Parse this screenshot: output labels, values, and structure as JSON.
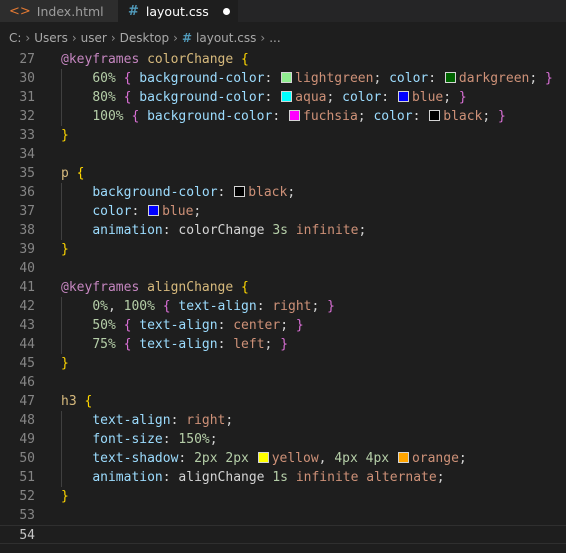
{
  "tabs": [
    {
      "label": "Index.html",
      "icon": "html-file-icon"
    },
    {
      "label": "layout.css",
      "icon": "css-file-icon",
      "modified": true
    }
  ],
  "breadcrumb": [
    "C:",
    "Users",
    "user",
    "Desktop",
    "layout.css",
    "..."
  ],
  "colors": {
    "lightgreen": "#90ee90",
    "darkgreen": "#006400",
    "aqua": "#00ffff",
    "blue": "#0000ff",
    "fuchsia": "#ff00ff",
    "black": "#000000",
    "yellow": "#ffff00",
    "orange": "#ffa500"
  },
  "lines": [
    {
      "n": "27",
      "tokens": [
        [
          "kw",
          "@keyframes"
        ],
        [
          "sel",
          " colorChange "
        ],
        [
          "br1",
          "{"
        ]
      ]
    },
    {
      "n": "30",
      "tokens": [
        [
          "ws",
          "    "
        ],
        [
          "num",
          "60%"
        ],
        [
          "punc",
          " "
        ],
        [
          "br2",
          "{"
        ],
        [
          "punc",
          " "
        ],
        [
          "prop",
          "background-color"
        ],
        [
          "punc",
          ": "
        ],
        [
          "sw",
          "lightgreen"
        ],
        [
          "val",
          "lightgreen"
        ],
        [
          "punc",
          "; "
        ],
        [
          "prop",
          "color"
        ],
        [
          "punc",
          ": "
        ],
        [
          "sw",
          "darkgreen"
        ],
        [
          "val",
          "darkgreen"
        ],
        [
          "punc",
          "; "
        ],
        [
          "br2",
          "}"
        ]
      ]
    },
    {
      "n": "31",
      "tokens": [
        [
          "ws",
          "    "
        ],
        [
          "num",
          "80%"
        ],
        [
          "punc",
          " "
        ],
        [
          "br2",
          "{"
        ],
        [
          "punc",
          " "
        ],
        [
          "prop",
          "background-color"
        ],
        [
          "punc",
          ": "
        ],
        [
          "sw",
          "aqua"
        ],
        [
          "val",
          "aqua"
        ],
        [
          "punc",
          "; "
        ],
        [
          "prop",
          "color"
        ],
        [
          "punc",
          ": "
        ],
        [
          "sw",
          "blue"
        ],
        [
          "val",
          "blue"
        ],
        [
          "punc",
          "; "
        ],
        [
          "br2",
          "}"
        ]
      ]
    },
    {
      "n": "32",
      "tokens": [
        [
          "ws",
          "    "
        ],
        [
          "num",
          "100%"
        ],
        [
          "punc",
          " "
        ],
        [
          "br2",
          "{"
        ],
        [
          "punc",
          " "
        ],
        [
          "prop",
          "background-color"
        ],
        [
          "punc",
          ": "
        ],
        [
          "sw",
          "fuchsia"
        ],
        [
          "val",
          "fuchsia"
        ],
        [
          "punc",
          "; "
        ],
        [
          "prop",
          "color"
        ],
        [
          "punc",
          ": "
        ],
        [
          "sw",
          "black"
        ],
        [
          "val",
          "black"
        ],
        [
          "punc",
          "; "
        ],
        [
          "br2",
          "}"
        ]
      ]
    },
    {
      "n": "33",
      "tokens": [
        [
          "br1",
          "}"
        ]
      ]
    },
    {
      "n": "34",
      "tokens": []
    },
    {
      "n": "35",
      "tokens": [
        [
          "sel",
          "p "
        ],
        [
          "br1",
          "{"
        ]
      ]
    },
    {
      "n": "36",
      "tokens": [
        [
          "ws",
          "    "
        ],
        [
          "prop",
          "background-color"
        ],
        [
          "punc",
          ": "
        ],
        [
          "sw",
          "black"
        ],
        [
          "val",
          "black"
        ],
        [
          "punc",
          ";"
        ]
      ]
    },
    {
      "n": "37",
      "tokens": [
        [
          "ws",
          "    "
        ],
        [
          "prop",
          "color"
        ],
        [
          "punc",
          ": "
        ],
        [
          "sw",
          "blue"
        ],
        [
          "val",
          "blue"
        ],
        [
          "punc",
          ";"
        ]
      ]
    },
    {
      "n": "38",
      "tokens": [
        [
          "ws",
          "    "
        ],
        [
          "prop",
          "animation"
        ],
        [
          "punc",
          ": colorChange "
        ],
        [
          "num",
          "3s"
        ],
        [
          "punc",
          " "
        ],
        [
          "val",
          "infinite"
        ],
        [
          "punc",
          ";"
        ]
      ]
    },
    {
      "n": "39",
      "tokens": [
        [
          "br1",
          "}"
        ]
      ]
    },
    {
      "n": "40",
      "tokens": []
    },
    {
      "n": "41",
      "tokens": [
        [
          "kw",
          "@keyframes"
        ],
        [
          "sel",
          " alignChange "
        ],
        [
          "br1",
          "{"
        ]
      ]
    },
    {
      "n": "42",
      "tokens": [
        [
          "ws",
          "    "
        ],
        [
          "num",
          "0%"
        ],
        [
          "punc",
          ", "
        ],
        [
          "num",
          "100%"
        ],
        [
          "punc",
          " "
        ],
        [
          "br2",
          "{"
        ],
        [
          "punc",
          " "
        ],
        [
          "prop",
          "text-align"
        ],
        [
          "punc",
          ": "
        ],
        [
          "val",
          "right"
        ],
        [
          "punc",
          "; "
        ],
        [
          "br2",
          "}"
        ]
      ]
    },
    {
      "n": "43",
      "tokens": [
        [
          "ws",
          "    "
        ],
        [
          "num",
          "50%"
        ],
        [
          "punc",
          " "
        ],
        [
          "br2",
          "{"
        ],
        [
          "punc",
          " "
        ],
        [
          "prop",
          "text-align"
        ],
        [
          "punc",
          ": "
        ],
        [
          "val",
          "center"
        ],
        [
          "punc",
          "; "
        ],
        [
          "br2",
          "}"
        ]
      ]
    },
    {
      "n": "44",
      "tokens": [
        [
          "ws",
          "    "
        ],
        [
          "num",
          "75%"
        ],
        [
          "punc",
          " "
        ],
        [
          "br2",
          "{"
        ],
        [
          "punc",
          " "
        ],
        [
          "prop",
          "text-align"
        ],
        [
          "punc",
          ": "
        ],
        [
          "val",
          "left"
        ],
        [
          "punc",
          "; "
        ],
        [
          "br2",
          "}"
        ]
      ]
    },
    {
      "n": "45",
      "tokens": [
        [
          "br1",
          "}"
        ]
      ]
    },
    {
      "n": "46",
      "tokens": []
    },
    {
      "n": "47",
      "tokens": [
        [
          "sel",
          "h3 "
        ],
        [
          "br1",
          "{"
        ]
      ]
    },
    {
      "n": "48",
      "tokens": [
        [
          "ws",
          "    "
        ],
        [
          "prop",
          "text-align"
        ],
        [
          "punc",
          ": "
        ],
        [
          "val",
          "right"
        ],
        [
          "punc",
          ";"
        ]
      ]
    },
    {
      "n": "49",
      "tokens": [
        [
          "ws",
          "    "
        ],
        [
          "prop",
          "font-size"
        ],
        [
          "punc",
          ": "
        ],
        [
          "num",
          "150%"
        ],
        [
          "punc",
          ";"
        ]
      ]
    },
    {
      "n": "50",
      "tokens": [
        [
          "ws",
          "    "
        ],
        [
          "prop",
          "text-shadow"
        ],
        [
          "punc",
          ": "
        ],
        [
          "num",
          "2px"
        ],
        [
          "punc",
          " "
        ],
        [
          "num",
          "2px"
        ],
        [
          "punc",
          " "
        ],
        [
          "sw",
          "yellow"
        ],
        [
          "val",
          "yellow"
        ],
        [
          "punc",
          ", "
        ],
        [
          "num",
          "4px"
        ],
        [
          "punc",
          " "
        ],
        [
          "num",
          "4px"
        ],
        [
          "punc",
          " "
        ],
        [
          "sw",
          "orange"
        ],
        [
          "val",
          "orange"
        ],
        [
          "punc",
          ";"
        ]
      ]
    },
    {
      "n": "51",
      "tokens": [
        [
          "ws",
          "    "
        ],
        [
          "prop",
          "animation"
        ],
        [
          "punc",
          ": alignChange "
        ],
        [
          "num",
          "1s"
        ],
        [
          "punc",
          " "
        ],
        [
          "val",
          "infinite alternate"
        ],
        [
          "punc",
          ";"
        ]
      ]
    },
    {
      "n": "52",
      "tokens": [
        [
          "br1",
          "}"
        ]
      ]
    },
    {
      "n": "53",
      "tokens": []
    },
    {
      "n": "54",
      "tokens": [],
      "current": true
    }
  ]
}
